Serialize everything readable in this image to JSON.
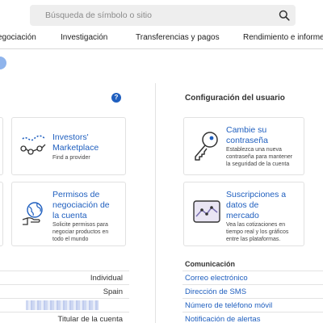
{
  "search": {
    "placeholder": "Búsqueda de símbolo o sitio"
  },
  "nav": {
    "items": [
      {
        "label": "egociación"
      },
      {
        "label": "Investigación"
      },
      {
        "label": "Transferencias y pagos"
      },
      {
        "label": "Rendimiento e informes"
      }
    ]
  },
  "left": {
    "cards": [
      {
        "title_line1": "Investors'",
        "title_line2": "Marketplace",
        "desc_line1": "Find a provider",
        "icon": "network-icon"
      },
      {
        "title_line1": "Permisos de",
        "title_line2": "negociación de",
        "title_line3": "la cuenta",
        "desc_line1": "Solicite permisos para",
        "desc_line2": "negociar productos en",
        "desc_line3": "todo el mundo",
        "icon": "globe-hand-icon"
      }
    ],
    "account_rows": [
      {
        "value": "Individual"
      },
      {
        "value": "Spain"
      },
      {
        "value": ""
      },
      {
        "value": "Titular de la cuenta"
      }
    ]
  },
  "user_config": {
    "title": "Configuración del usuario",
    "cards": [
      {
        "title_line1": "Cambie su",
        "title_line2": "contraseña",
        "desc_line1": "Establezca una nueva",
        "desc_line2": "contraseña para mantener",
        "desc_line3": "la seguridad de la cuenta",
        "icon": "key-icon"
      },
      {
        "title_line1": "Suscripciones a",
        "title_line2": "datos de",
        "title_line3": "mercado",
        "desc_line1": "Vea las cotizaciones en",
        "desc_line2": "tiempo real y los gráficos",
        "desc_line3": "entre las plataformas.",
        "icon": "market-chart-icon"
      }
    ]
  },
  "communication": {
    "title": "Comunicación",
    "items": [
      {
        "label": "Correo electrónico"
      },
      {
        "label": "Dirección de SMS"
      },
      {
        "label": "Número de teléfono móvil"
      },
      {
        "label": "Notificación de alertas"
      }
    ]
  },
  "colors": {
    "link": "#1f5fbf",
    "accent_dot": "#8fb4ec",
    "search_bg": "#eeeeee"
  }
}
